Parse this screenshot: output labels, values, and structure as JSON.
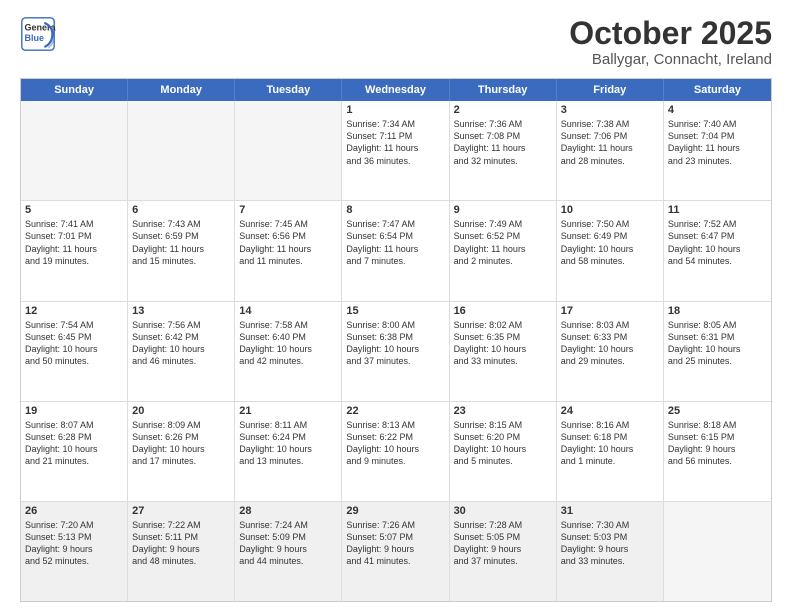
{
  "logo": {
    "line1": "General",
    "line2": "Blue"
  },
  "title": "October 2025",
  "subtitle": "Ballygar, Connacht, Ireland",
  "weekdays": [
    "Sunday",
    "Monday",
    "Tuesday",
    "Wednesday",
    "Thursday",
    "Friday",
    "Saturday"
  ],
  "rows": [
    [
      {
        "day": "",
        "lines": [],
        "empty": true
      },
      {
        "day": "",
        "lines": [],
        "empty": true
      },
      {
        "day": "",
        "lines": [],
        "empty": true
      },
      {
        "day": "1",
        "lines": [
          "Sunrise: 7:34 AM",
          "Sunset: 7:11 PM",
          "Daylight: 11 hours",
          "and 36 minutes."
        ]
      },
      {
        "day": "2",
        "lines": [
          "Sunrise: 7:36 AM",
          "Sunset: 7:08 PM",
          "Daylight: 11 hours",
          "and 32 minutes."
        ]
      },
      {
        "day": "3",
        "lines": [
          "Sunrise: 7:38 AM",
          "Sunset: 7:06 PM",
          "Daylight: 11 hours",
          "and 28 minutes."
        ]
      },
      {
        "day": "4",
        "lines": [
          "Sunrise: 7:40 AM",
          "Sunset: 7:04 PM",
          "Daylight: 11 hours",
          "and 23 minutes."
        ]
      }
    ],
    [
      {
        "day": "5",
        "lines": [
          "Sunrise: 7:41 AM",
          "Sunset: 7:01 PM",
          "Daylight: 11 hours",
          "and 19 minutes."
        ]
      },
      {
        "day": "6",
        "lines": [
          "Sunrise: 7:43 AM",
          "Sunset: 6:59 PM",
          "Daylight: 11 hours",
          "and 15 minutes."
        ]
      },
      {
        "day": "7",
        "lines": [
          "Sunrise: 7:45 AM",
          "Sunset: 6:56 PM",
          "Daylight: 11 hours",
          "and 11 minutes."
        ]
      },
      {
        "day": "8",
        "lines": [
          "Sunrise: 7:47 AM",
          "Sunset: 6:54 PM",
          "Daylight: 11 hours",
          "and 7 minutes."
        ]
      },
      {
        "day": "9",
        "lines": [
          "Sunrise: 7:49 AM",
          "Sunset: 6:52 PM",
          "Daylight: 11 hours",
          "and 2 minutes."
        ]
      },
      {
        "day": "10",
        "lines": [
          "Sunrise: 7:50 AM",
          "Sunset: 6:49 PM",
          "Daylight: 10 hours",
          "and 58 minutes."
        ]
      },
      {
        "day": "11",
        "lines": [
          "Sunrise: 7:52 AM",
          "Sunset: 6:47 PM",
          "Daylight: 10 hours",
          "and 54 minutes."
        ]
      }
    ],
    [
      {
        "day": "12",
        "lines": [
          "Sunrise: 7:54 AM",
          "Sunset: 6:45 PM",
          "Daylight: 10 hours",
          "and 50 minutes."
        ]
      },
      {
        "day": "13",
        "lines": [
          "Sunrise: 7:56 AM",
          "Sunset: 6:42 PM",
          "Daylight: 10 hours",
          "and 46 minutes."
        ]
      },
      {
        "day": "14",
        "lines": [
          "Sunrise: 7:58 AM",
          "Sunset: 6:40 PM",
          "Daylight: 10 hours",
          "and 42 minutes."
        ]
      },
      {
        "day": "15",
        "lines": [
          "Sunrise: 8:00 AM",
          "Sunset: 6:38 PM",
          "Daylight: 10 hours",
          "and 37 minutes."
        ]
      },
      {
        "day": "16",
        "lines": [
          "Sunrise: 8:02 AM",
          "Sunset: 6:35 PM",
          "Daylight: 10 hours",
          "and 33 minutes."
        ]
      },
      {
        "day": "17",
        "lines": [
          "Sunrise: 8:03 AM",
          "Sunset: 6:33 PM",
          "Daylight: 10 hours",
          "and 29 minutes."
        ]
      },
      {
        "day": "18",
        "lines": [
          "Sunrise: 8:05 AM",
          "Sunset: 6:31 PM",
          "Daylight: 10 hours",
          "and 25 minutes."
        ]
      }
    ],
    [
      {
        "day": "19",
        "lines": [
          "Sunrise: 8:07 AM",
          "Sunset: 6:28 PM",
          "Daylight: 10 hours",
          "and 21 minutes."
        ]
      },
      {
        "day": "20",
        "lines": [
          "Sunrise: 8:09 AM",
          "Sunset: 6:26 PM",
          "Daylight: 10 hours",
          "and 17 minutes."
        ]
      },
      {
        "day": "21",
        "lines": [
          "Sunrise: 8:11 AM",
          "Sunset: 6:24 PM",
          "Daylight: 10 hours",
          "and 13 minutes."
        ]
      },
      {
        "day": "22",
        "lines": [
          "Sunrise: 8:13 AM",
          "Sunset: 6:22 PM",
          "Daylight: 10 hours",
          "and 9 minutes."
        ]
      },
      {
        "day": "23",
        "lines": [
          "Sunrise: 8:15 AM",
          "Sunset: 6:20 PM",
          "Daylight: 10 hours",
          "and 5 minutes."
        ]
      },
      {
        "day": "24",
        "lines": [
          "Sunrise: 8:16 AM",
          "Sunset: 6:18 PM",
          "Daylight: 10 hours",
          "and 1 minute."
        ]
      },
      {
        "day": "25",
        "lines": [
          "Sunrise: 8:18 AM",
          "Sunset: 6:15 PM",
          "Daylight: 9 hours",
          "and 56 minutes."
        ]
      }
    ],
    [
      {
        "day": "26",
        "lines": [
          "Sunrise: 7:20 AM",
          "Sunset: 5:13 PM",
          "Daylight: 9 hours",
          "and 52 minutes."
        ],
        "shaded": true
      },
      {
        "day": "27",
        "lines": [
          "Sunrise: 7:22 AM",
          "Sunset: 5:11 PM",
          "Daylight: 9 hours",
          "and 48 minutes."
        ],
        "shaded": true
      },
      {
        "day": "28",
        "lines": [
          "Sunrise: 7:24 AM",
          "Sunset: 5:09 PM",
          "Daylight: 9 hours",
          "and 44 minutes."
        ],
        "shaded": true
      },
      {
        "day": "29",
        "lines": [
          "Sunrise: 7:26 AM",
          "Sunset: 5:07 PM",
          "Daylight: 9 hours",
          "and 41 minutes."
        ],
        "shaded": true
      },
      {
        "day": "30",
        "lines": [
          "Sunrise: 7:28 AM",
          "Sunset: 5:05 PM",
          "Daylight: 9 hours",
          "and 37 minutes."
        ],
        "shaded": true
      },
      {
        "day": "31",
        "lines": [
          "Sunrise: 7:30 AM",
          "Sunset: 5:03 PM",
          "Daylight: 9 hours",
          "and 33 minutes."
        ],
        "shaded": true
      },
      {
        "day": "",
        "lines": [],
        "empty": true
      }
    ]
  ]
}
